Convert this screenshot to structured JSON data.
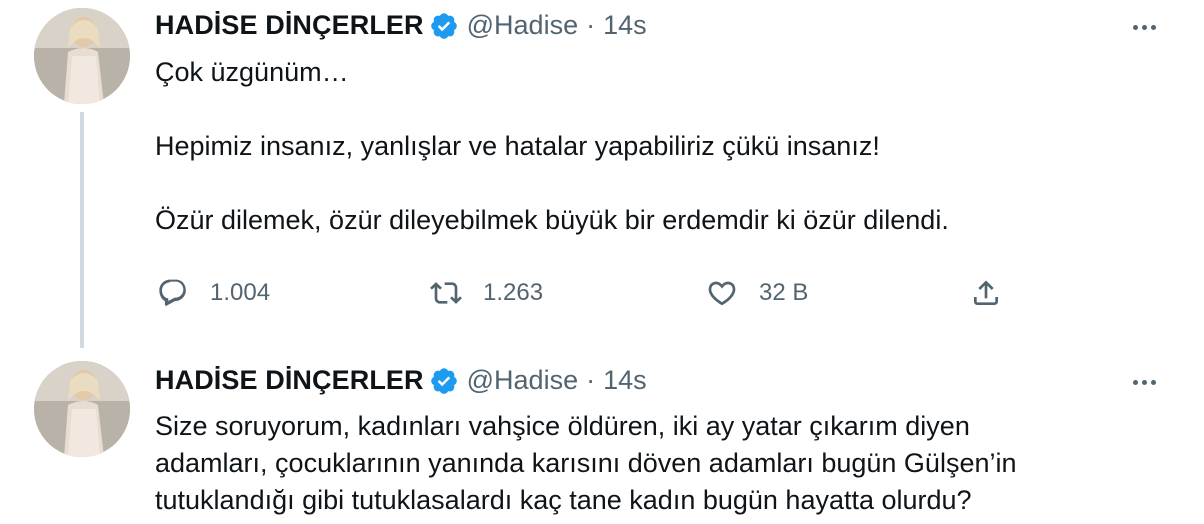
{
  "tweets": [
    {
      "author_name": "HADİSE DİNÇERLER",
      "handle": "@Hadise",
      "separator": "·",
      "time": "14s",
      "text": [
        "Çok üzgünüm…",
        "Hepimiz insanız, yanlışlar ve hatalar yapabiliriz çükü insanız!",
        "Özür dilemek, özür dileyebilmek büyük bir erdemdir ki özür dilendi."
      ],
      "actions": {
        "replies": "1.004",
        "retweets": "1.263",
        "likes": "32 B"
      }
    },
    {
      "author_name": "HADİSE DİNÇERLER",
      "handle": "@Hadise",
      "separator": "·",
      "time": "14s",
      "text": [
        "Size soruyorum, kadınları vahşice öldüren, iki ay yatar çıkarım diyen adamları, çocuklarının yanında karısını döven adamları bugün Gülşen’in tutuklandığı gibi tutuklasalardı kaç tane kadın bugün hayatta olurdu?"
      ]
    }
  ],
  "icons": {
    "verified": "verified-badge-icon",
    "more": "more-options-icon",
    "reply": "reply-icon",
    "retweet": "retweet-icon",
    "like": "heart-icon",
    "share": "share-icon"
  },
  "colors": {
    "text": "#0f1419",
    "secondary": "#536471",
    "verified": "#1d9bf0",
    "thread_line": "#cfd9de"
  }
}
